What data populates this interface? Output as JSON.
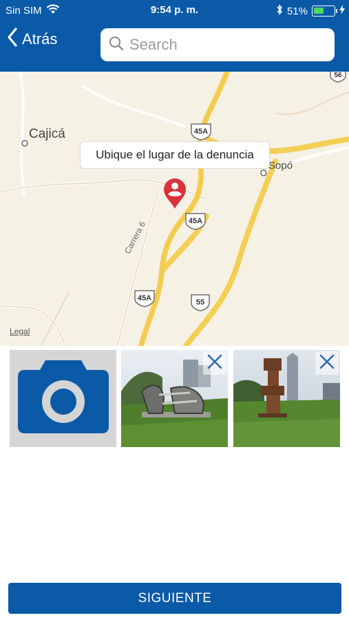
{
  "status_bar": {
    "carrier": "Sin SIM",
    "time": "9:54 p. m.",
    "battery": "51%",
    "battery_level": 0.51
  },
  "nav": {
    "back_label": "Atrás",
    "search_placeholder": "Search"
  },
  "map": {
    "callout": "Ubique el lugar de la denuncia",
    "places": {
      "cajica": "Cajicá",
      "sopo": "Sopó"
    },
    "road_name": "Carrera 6",
    "shields": [
      "56",
      "45A",
      "45A",
      "45A",
      "55"
    ],
    "legal": "Legal"
  },
  "photos": {
    "add_icon": "camera-icon",
    "items": [
      {
        "name": "photo-sculpture-1",
        "remove_icon": "close-icon"
      },
      {
        "name": "photo-sculpture-2",
        "remove_icon": "close-icon"
      }
    ]
  },
  "footer": {
    "next_label": "SIGUIENTE"
  },
  "colors": {
    "brand_blue": "#0a5aa8",
    "map_bg": "#f6f1e5",
    "road_yellow": "#f4cf55",
    "pin_red": "#d8323c"
  }
}
